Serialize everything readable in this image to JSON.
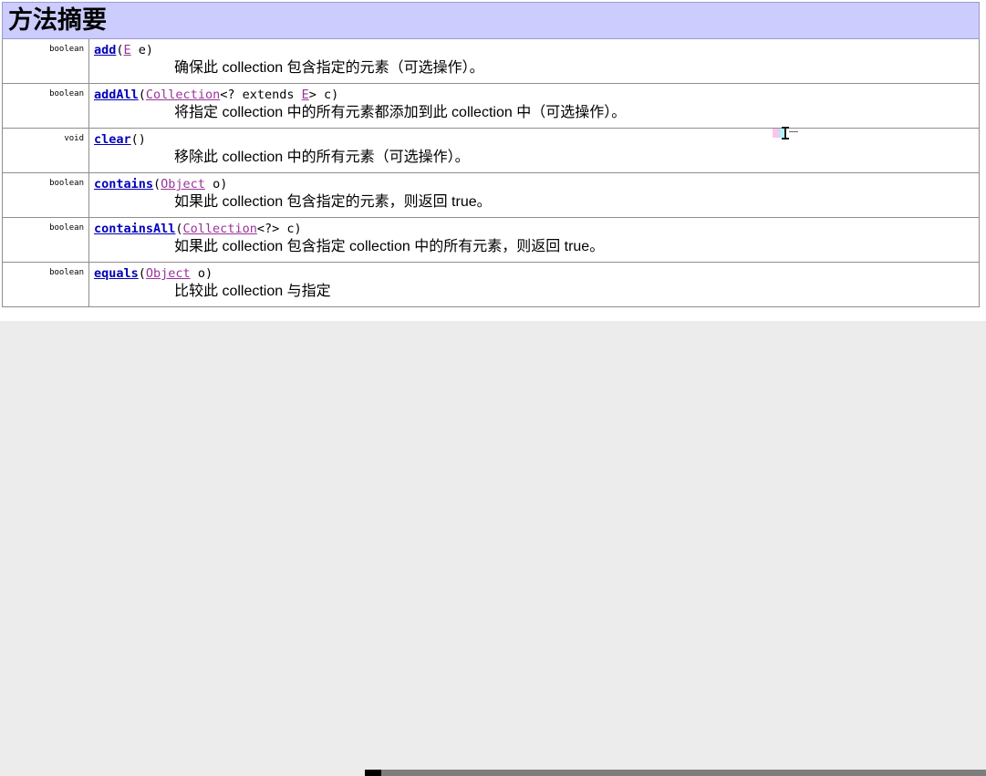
{
  "document": {
    "section_title": "方法摘要",
    "header_bg": "#ccccff",
    "link_color": "#0000bb",
    "type_link_color": "#993399",
    "methods": [
      {
        "return_type": "boolean",
        "name": "add",
        "paren_open": "(",
        "params_pre": "",
        "param_type": "E",
        "params_post": " e)",
        "description": "确保此 collection 包含指定的元素（可选操作）。"
      },
      {
        "return_type": "boolean",
        "name": "addAll",
        "paren_open": "(",
        "params_pre": "",
        "param_type": "Collection",
        "params_post": "<? extends ",
        "param_type2": "E",
        "params_post2": "> c)",
        "description": "将指定 collection 中的所有元素都添加到此 collection 中（可选操作）。"
      },
      {
        "return_type": "void",
        "name": "clear",
        "paren_open": "(",
        "params_pre": "",
        "param_type": "",
        "params_post": ")",
        "description": "移除此 collection 中的所有元素（可选操作）。"
      },
      {
        "return_type": "boolean",
        "name": "contains",
        "paren_open": "(",
        "params_pre": "",
        "param_type": "Object",
        "params_post": " o)",
        "description": "如果此 collection 包含指定的元素，则返回 true。"
      },
      {
        "return_type": "boolean",
        "name": "containsAll",
        "paren_open": "(",
        "params_pre": "",
        "param_type": "Collection",
        "params_post": "<?> c)",
        "description": "如果此 collection 包含指定 collection 中的所有元素，则返回 true。"
      },
      {
        "return_type": "boolean",
        "name": "equals",
        "paren_open": "(",
        "params_pre": "",
        "param_type": "Object",
        "params_post": " o)",
        "description": "比较此 collection 与指定"
      }
    ]
  },
  "scrollbar": {
    "orientation": "horizontal",
    "thumb_color": "#000000",
    "track_color": "#7d7d7d"
  },
  "cursor": {
    "kind": "text-ibeam-cursor"
  }
}
